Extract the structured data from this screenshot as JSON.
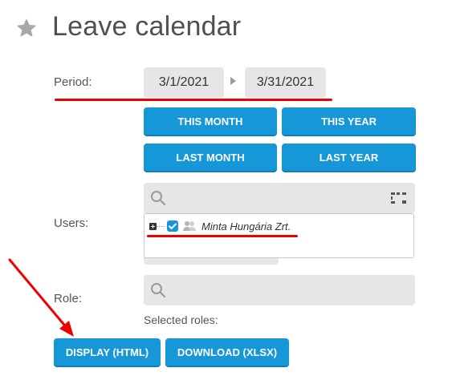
{
  "page": {
    "title": "Leave calendar"
  },
  "period": {
    "label": "Period:",
    "start": "3/1/2021",
    "end": "3/31/2021",
    "buttons": [
      "THIS MONTH",
      "THIS YEAR",
      "LAST MONTH",
      "LAST YEAR"
    ]
  },
  "users": {
    "label": "Users:",
    "search_placeholder": "",
    "tree": {
      "item_label": "Minta Hungária Zrt.",
      "checked": true
    }
  },
  "role": {
    "label": "Role:",
    "search_placeholder": "",
    "selected_label": "Selected roles:"
  },
  "actions": {
    "display": "DISPLAY (HTML)",
    "download": "DOWNLOAD (XLSX)"
  },
  "colors": {
    "accent": "#1597d8",
    "annotation": "#ee0000"
  },
  "icons": [
    "star-icon",
    "search-icon",
    "tree-structure-icon",
    "expand-icon",
    "checkbox-icon",
    "group-users-icon",
    "annotation-arrow-icon"
  ]
}
